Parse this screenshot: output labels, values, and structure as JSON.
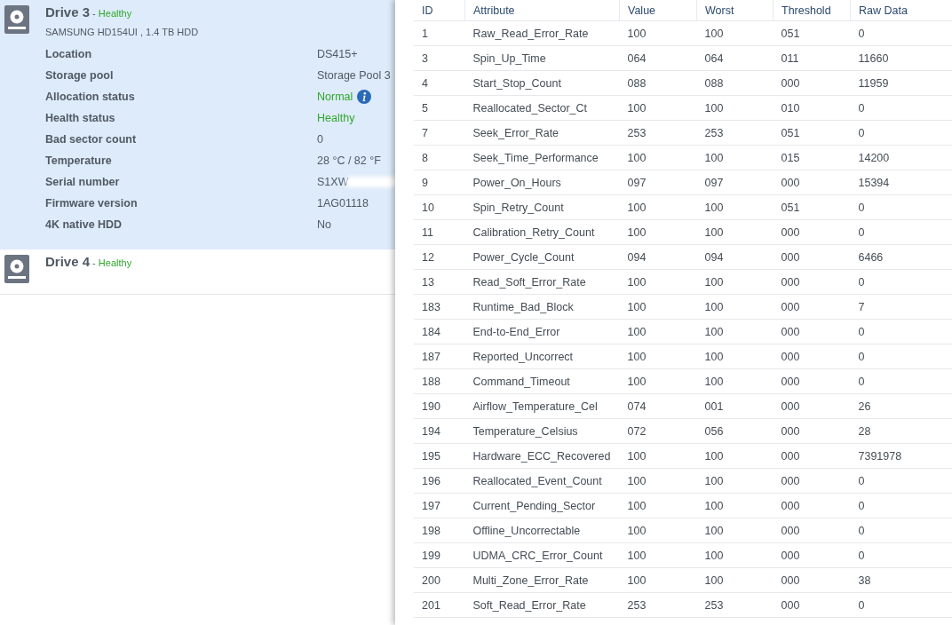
{
  "drives": [
    {
      "name": "Drive 3",
      "dash": "-",
      "status": "Healthy",
      "model": "SAMSUNG HD154UI , 1.4 TB HDD",
      "expanded": true,
      "details": [
        {
          "label": "Location",
          "value": "DS415+",
          "kind": "text"
        },
        {
          "label": "Storage pool",
          "value": "Storage Pool 3",
          "kind": "text"
        },
        {
          "label": "Allocation status",
          "value": "Normal",
          "kind": "status_info"
        },
        {
          "label": "Health status",
          "value": "Healthy",
          "kind": "status"
        },
        {
          "label": "Bad sector count",
          "value": "0",
          "kind": "text"
        },
        {
          "label": "Temperature",
          "value": "28 °C / 82 °F",
          "kind": "text"
        },
        {
          "label": "Serial number",
          "value": "S1XW",
          "kind": "redacted"
        },
        {
          "label": "Firmware version",
          "value": "1AG01118",
          "kind": "text"
        },
        {
          "label": "4K native HDD",
          "value": "No",
          "kind": "text"
        }
      ]
    },
    {
      "name": "Drive 4",
      "dash": "-",
      "status": "Healthy",
      "expanded": false
    }
  ],
  "smart_table": {
    "columns": [
      "ID",
      "Attribute",
      "Value",
      "Worst",
      "Threshold",
      "Raw Data"
    ],
    "rows": [
      [
        "1",
        "Raw_Read_Error_Rate",
        "100",
        "100",
        "051",
        "0"
      ],
      [
        "3",
        "Spin_Up_Time",
        "064",
        "064",
        "011",
        "11660"
      ],
      [
        "4",
        "Start_Stop_Count",
        "088",
        "088",
        "000",
        "11959"
      ],
      [
        "5",
        "Reallocated_Sector_Ct",
        "100",
        "100",
        "010",
        "0"
      ],
      [
        "7",
        "Seek_Error_Rate",
        "253",
        "253",
        "051",
        "0"
      ],
      [
        "8",
        "Seek_Time_Performance",
        "100",
        "100",
        "015",
        "14200"
      ],
      [
        "9",
        "Power_On_Hours",
        "097",
        "097",
        "000",
        "15394"
      ],
      [
        "10",
        "Spin_Retry_Count",
        "100",
        "100",
        "051",
        "0"
      ],
      [
        "11",
        "Calibration_Retry_Count",
        "100",
        "100",
        "000",
        "0"
      ],
      [
        "12",
        "Power_Cycle_Count",
        "094",
        "094",
        "000",
        "6466"
      ],
      [
        "13",
        "Read_Soft_Error_Rate",
        "100",
        "100",
        "000",
        "0"
      ],
      [
        "183",
        "Runtime_Bad_Block",
        "100",
        "100",
        "000",
        "7"
      ],
      [
        "184",
        "End-to-End_Error",
        "100",
        "100",
        "000",
        "0"
      ],
      [
        "187",
        "Reported_Uncorrect",
        "100",
        "100",
        "000",
        "0"
      ],
      [
        "188",
        "Command_Timeout",
        "100",
        "100",
        "000",
        "0"
      ],
      [
        "190",
        "Airflow_Temperature_Cel",
        "074",
        "001",
        "000",
        "26"
      ],
      [
        "194",
        "Temperature_Celsius",
        "072",
        "056",
        "000",
        "28"
      ],
      [
        "195",
        "Hardware_ECC_Recovered",
        "100",
        "100",
        "000",
        "7391978"
      ],
      [
        "196",
        "Reallocated_Event_Count",
        "100",
        "100",
        "000",
        "0"
      ],
      [
        "197",
        "Current_Pending_Sector",
        "100",
        "100",
        "000",
        "0"
      ],
      [
        "198",
        "Offline_Uncorrectable",
        "100",
        "100",
        "000",
        "0"
      ],
      [
        "199",
        "UDMA_CRC_Error_Count",
        "100",
        "100",
        "000",
        "0"
      ],
      [
        "200",
        "Multi_Zone_Error_Rate",
        "100",
        "100",
        "000",
        "38"
      ],
      [
        "201",
        "Soft_Read_Error_Rate",
        "253",
        "253",
        "000",
        "0"
      ]
    ]
  }
}
